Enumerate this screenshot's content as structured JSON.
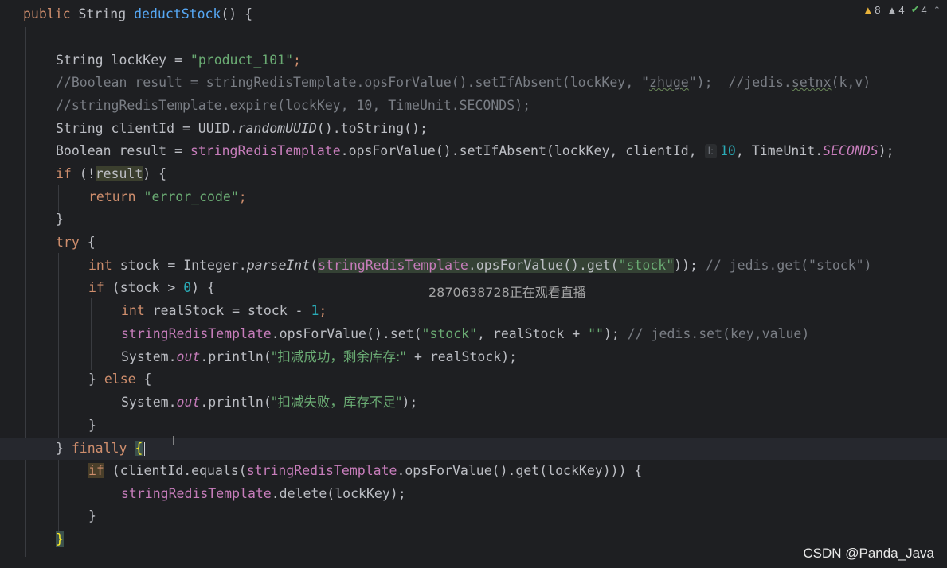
{
  "status": {
    "errors": "8",
    "warnings": "4",
    "ok": "4",
    "error_icon": "warning-triangle-yellow",
    "warning_icon": "warning-triangle-gray",
    "ok_icon": "double-check"
  },
  "code": {
    "l1": {
      "a": "public",
      "b": " String ",
      "c": "deductStock",
      "d": "() {"
    },
    "l3": {
      "a": "String lockKey = ",
      "b": "\"product_101\"",
      "c": ";"
    },
    "l4": {
      "a": "//Boolean result = stringRedisTemplate.opsForValue().setIfAbsent(lockKey, \"",
      "b": "zhuge",
      "c": "\");  //jedis.",
      "d": "setnx",
      "e": "(k,v)"
    },
    "l5": "//stringRedisTemplate.expire(lockKey, 10, TimeUnit.SECONDS);",
    "l6": {
      "a": "String clientId = UUID.",
      "b": "randomUUID",
      "c": "().toString();"
    },
    "l7": {
      "a": "Boolean result = ",
      "b": "stringRedisTemplate",
      "c": ".opsForValue().setIfAbsent(lockKey, clientId, ",
      "hint": "l:",
      "d": "10",
      "e": ", TimeUnit.",
      "f": "SECONDS",
      "g": ");"
    },
    "l8": {
      "a": "if",
      "b": " (!",
      "c": "result",
      "d": ") {"
    },
    "l9": {
      "a": "return",
      "b": " ",
      "c": "\"error_code\"",
      "d": ";"
    },
    "l10": "}",
    "l11": {
      "a": "try",
      "b": " {"
    },
    "l12": {
      "a": "int",
      "b": " stock = Integer.",
      "c": "parseInt",
      "d": "(",
      "e": "stringRedisTemplate",
      "f": ".opsForValue().get(",
      "g": "\"stock\"",
      "h": "));",
      "i": " // jedis.get(\"stock\")"
    },
    "l13": {
      "a": "if",
      "b": " (stock > ",
      "c": "0",
      "d": ") {"
    },
    "l14": {
      "a": "int",
      "b": " realStock = stock - ",
      "c": "1",
      "d": ";"
    },
    "l15": {
      "a": "stringRedisTemplate",
      "b": ".opsForValue().set(",
      "c": "\"stock\"",
      "d": ", realStock + ",
      "e": "\"\"",
      "f": ");",
      "g": " // jedis.set(key,value)"
    },
    "l16": {
      "a": "System.",
      "b": "out",
      "c": ".println(",
      "d": "\"扣减成功，剩余库存:\"",
      "e": " + realStock);"
    },
    "l17": {
      "a": "} ",
      "b": "else",
      "c": " {"
    },
    "l18": {
      "a": "System.",
      "b": "out",
      "c": ".println(",
      "d": "\"扣减失败，库存不足\"",
      "e": ");"
    },
    "l19": "}",
    "l20": {
      "a": "} ",
      "b": "finally",
      "c": " ",
      "d": "{"
    },
    "l21": {
      "a": "if",
      "b": " (clientId.equals(",
      "c": "stringRedisTemplate",
      "d": ".opsForValue().get(lockKey))) {"
    },
    "l22": {
      "a": "stringRedisTemplate",
      "b": ".delete(lockKey);"
    },
    "l23": "}",
    "l24": "}"
  },
  "overlay": "2870638728正在观看直播",
  "watermark": "CSDN @Panda_Java"
}
